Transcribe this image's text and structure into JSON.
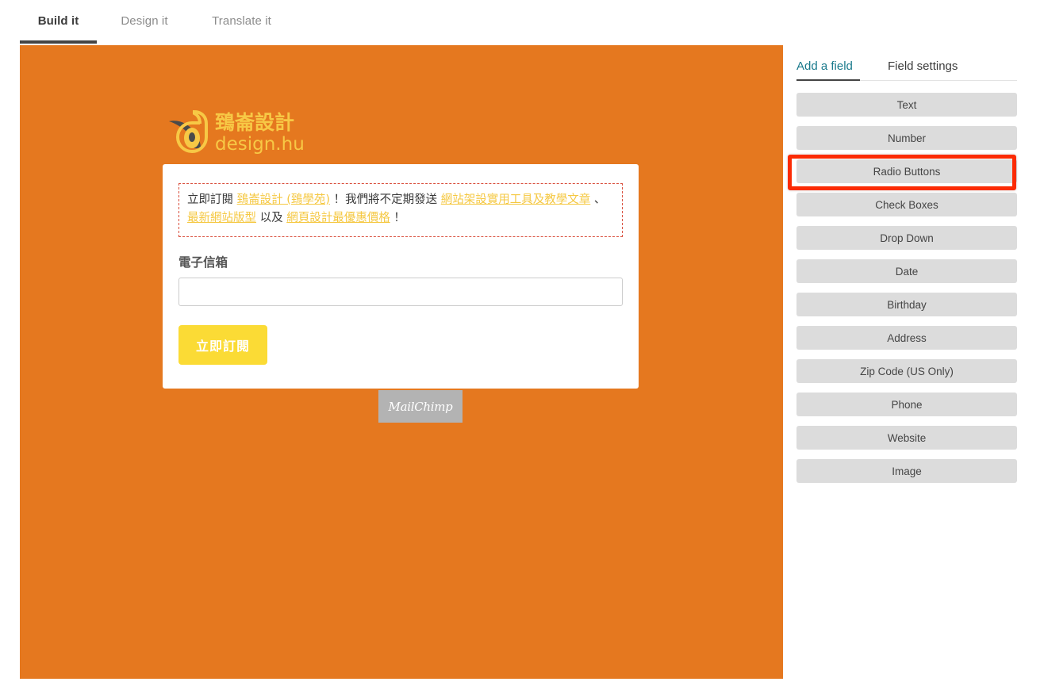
{
  "header": {
    "tabs": [
      {
        "label": "Build it",
        "active": true
      },
      {
        "label": "Design it",
        "active": false
      },
      {
        "label": "Translate it",
        "active": false
      }
    ]
  },
  "preview": {
    "background_color": "#e5781f",
    "logo": {
      "icon": "designhu-swan-logo",
      "chinese_name": "鵄崙設計",
      "latin_name": "design.hu",
      "mark_color": "#4a4a4a",
      "accent_color": "#f7c845"
    },
    "form": {
      "notice": {
        "border_color": "#d94f3d",
        "link_color": "#f5c842",
        "segments": [
          {
            "type": "text",
            "text": "立即訂閱 "
          },
          {
            "type": "link",
            "text": "鵄崙設計 (鵄學苑)"
          },
          {
            "type": "text",
            "text": " ！我們將不定期發送 "
          },
          {
            "type": "link",
            "text": "網站架設實用工具及教學文章"
          },
          {
            "type": "text",
            "text": " 、"
          },
          {
            "type": "link",
            "text": "最新網站版型"
          },
          {
            "type": "text",
            "text": " 以及 "
          },
          {
            "type": "link",
            "text": "網頁設計最優惠價格"
          },
          {
            "type": "text",
            "text": " ！"
          }
        ]
      },
      "email_label": "電子信箱",
      "email_value": "",
      "email_placeholder": "",
      "submit_label": "立即訂閱",
      "submit_color": "#fbdb35"
    },
    "badge": {
      "label": "MailChimp",
      "background_color": "#b3b3b3"
    }
  },
  "sidebar": {
    "tabs": [
      {
        "label": "Add a field",
        "active": true
      },
      {
        "label": "Field settings",
        "active": false
      }
    ],
    "active_tab_color": "#1a7a8c",
    "field_buttons": [
      {
        "label": "Text",
        "highlighted": false
      },
      {
        "label": "Number",
        "highlighted": false
      },
      {
        "label": "Radio Buttons",
        "highlighted": true
      },
      {
        "label": "Check Boxes",
        "highlighted": false
      },
      {
        "label": "Drop Down",
        "highlighted": false
      },
      {
        "label": "Date",
        "highlighted": false
      },
      {
        "label": "Birthday",
        "highlighted": false
      },
      {
        "label": "Address",
        "highlighted": false
      },
      {
        "label": "Zip Code (US Only)",
        "highlighted": false
      },
      {
        "label": "Phone",
        "highlighted": false
      },
      {
        "label": "Website",
        "highlighted": false
      },
      {
        "label": "Image",
        "highlighted": false
      }
    ],
    "highlight_color": "#fb2b04"
  }
}
